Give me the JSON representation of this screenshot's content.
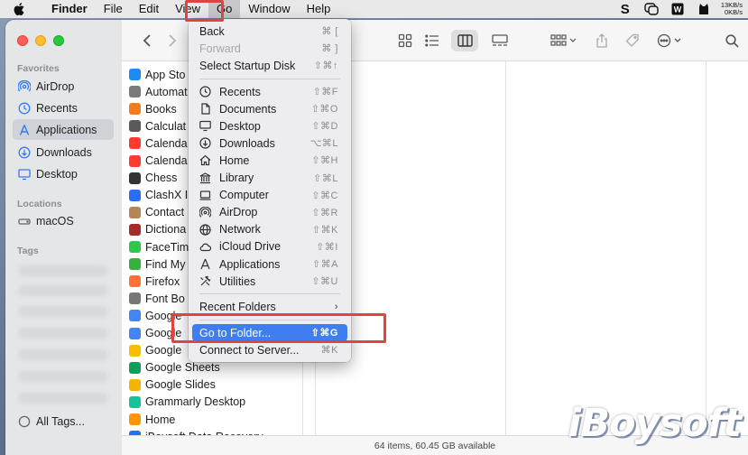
{
  "menubar": {
    "app_name": "Finder",
    "items": [
      "File",
      "Edit",
      "View",
      "Go",
      "Window",
      "Help"
    ],
    "network_up": "13KB/s",
    "network_down": "0KB/s"
  },
  "sidebar": {
    "favorites_heading": "Favorites",
    "favorites": [
      {
        "label": "AirDrop",
        "icon": "airdrop-icon"
      },
      {
        "label": "Recents",
        "icon": "clock-icon"
      },
      {
        "label": "Applications",
        "icon": "applications-icon",
        "selected": true
      },
      {
        "label": "Downloads",
        "icon": "download-icon"
      },
      {
        "label": "Desktop",
        "icon": "desktop-icon"
      }
    ],
    "locations_heading": "Locations",
    "locations": [
      {
        "label": "macOS",
        "icon": "drive-icon"
      }
    ],
    "tags_heading": "Tags",
    "all_tags": "All Tags..."
  },
  "apps": [
    {
      "label": "App Sto",
      "color": "#1b8ef6"
    },
    {
      "label": "Automat",
      "color": "#7a7a7a"
    },
    {
      "label": "Books",
      "color": "#f57c1e"
    },
    {
      "label": "Calculat",
      "color": "#5a5a5a"
    },
    {
      "label": "Calenda",
      "color": "#ff3b30"
    },
    {
      "label": "Calenda",
      "color": "#ff3b30"
    },
    {
      "label": "Chess",
      "color": "#333333"
    },
    {
      "label": "ClashX I",
      "color": "#2d6cf6"
    },
    {
      "label": "Contact",
      "color": "#b58555"
    },
    {
      "label": "Dictiona",
      "color": "#a52a2a"
    },
    {
      "label": "FaceTim",
      "color": "#2ec94a"
    },
    {
      "label": "Find My",
      "color": "#38b03f"
    },
    {
      "label": "Firefox",
      "color": "#ff7139"
    },
    {
      "label": "Font Bo",
      "color": "#777777"
    },
    {
      "label": "Google",
      "color": "#4285f4"
    },
    {
      "label": "Google",
      "color": "#4285f4"
    },
    {
      "label": "Google",
      "color": "#fbbc04"
    },
    {
      "label": "Google Sheets",
      "color": "#0f9d58"
    },
    {
      "label": "Google Slides",
      "color": "#f4b400"
    },
    {
      "label": "Grammarly Desktop",
      "color": "#15c39a"
    },
    {
      "label": "Home",
      "color": "#ff9500"
    },
    {
      "label": "iBoysoft Data Recovery",
      "color": "#2a6df4"
    }
  ],
  "go_menu": {
    "top_items": [
      {
        "label": "Back",
        "shortcut": "⌘ [",
        "disabled": false
      },
      {
        "label": "Forward",
        "shortcut": "⌘ ]",
        "disabled": true
      },
      {
        "label": "Select Startup Disk",
        "shortcut": "⇧⌘↑",
        "disabled": false
      }
    ],
    "places": [
      {
        "label": "Recents",
        "shortcut": "⇧⌘F",
        "icon": "clock-icon"
      },
      {
        "label": "Documents",
        "shortcut": "⇧⌘O",
        "icon": "document-icon"
      },
      {
        "label": "Desktop",
        "shortcut": "⇧⌘D",
        "icon": "desktop-icon"
      },
      {
        "label": "Downloads",
        "shortcut": "⌥⌘L",
        "icon": "download-icon"
      },
      {
        "label": "Home",
        "shortcut": "⇧⌘H",
        "icon": "home-icon"
      },
      {
        "label": "Library",
        "shortcut": "⇧⌘L",
        "icon": "library-icon"
      },
      {
        "label": "Computer",
        "shortcut": "⇧⌘C",
        "icon": "computer-icon"
      },
      {
        "label": "AirDrop",
        "shortcut": "⇧⌘R",
        "icon": "airdrop-icon"
      },
      {
        "label": "Network",
        "shortcut": "⇧⌘K",
        "icon": "globe-icon"
      },
      {
        "label": "iCloud Drive",
        "shortcut": "⇧⌘I",
        "icon": "cloud-icon"
      },
      {
        "label": "Applications",
        "shortcut": "⇧⌘A",
        "icon": "applications-icon"
      },
      {
        "label": "Utilities",
        "shortcut": "⇧⌘U",
        "icon": "tools-icon"
      }
    ],
    "recent_folders": "Recent Folders",
    "go_to_folder": {
      "label": "Go to Folder...",
      "shortcut": "⇧⌘G"
    },
    "connect": {
      "label": "Connect to Server...",
      "shortcut": "⌘K"
    }
  },
  "status_bar": "64 items, 60.45 GB available",
  "watermark": "iBoysoft"
}
